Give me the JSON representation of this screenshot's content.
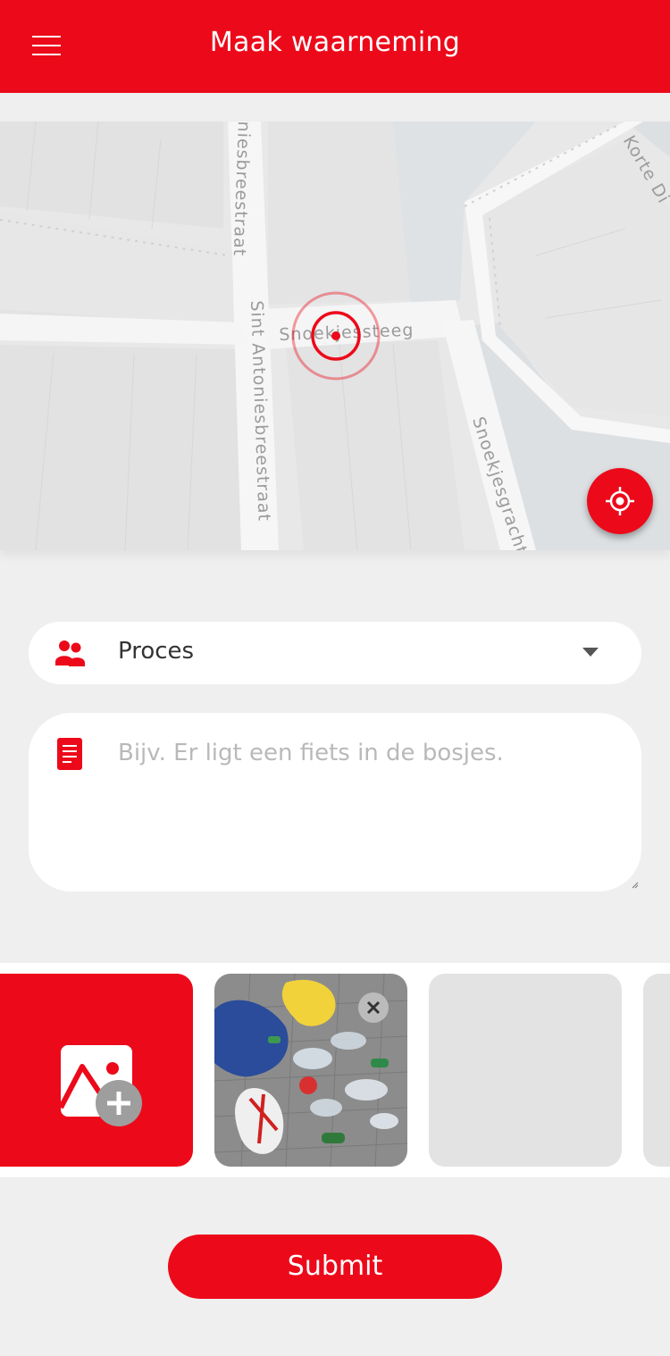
{
  "header": {
    "title": "Maak waarneming",
    "menu_icon": "hamburger-menu-icon"
  },
  "map": {
    "streets": [
      "niesbreestraat",
      "Sint Antoniesbreestraat",
      "Snoekjessteeg",
      "Snoekjesgracht",
      "Korte Di"
    ],
    "locate_icon": "crosshair-icon",
    "accent": "#ec0a1a"
  },
  "category": {
    "icon": "users-icon",
    "value": "Proces"
  },
  "description": {
    "icon": "document-icon",
    "placeholder": "Bijv. Er ligt een fiets in de bosjes.",
    "value": ""
  },
  "photos": {
    "add_icon": "add-image-icon",
    "remove_icon": "close-icon",
    "count": 1
  },
  "submit": {
    "label": "Submit"
  },
  "colors": {
    "primary": "#ec0a1a",
    "background": "#efefef"
  }
}
